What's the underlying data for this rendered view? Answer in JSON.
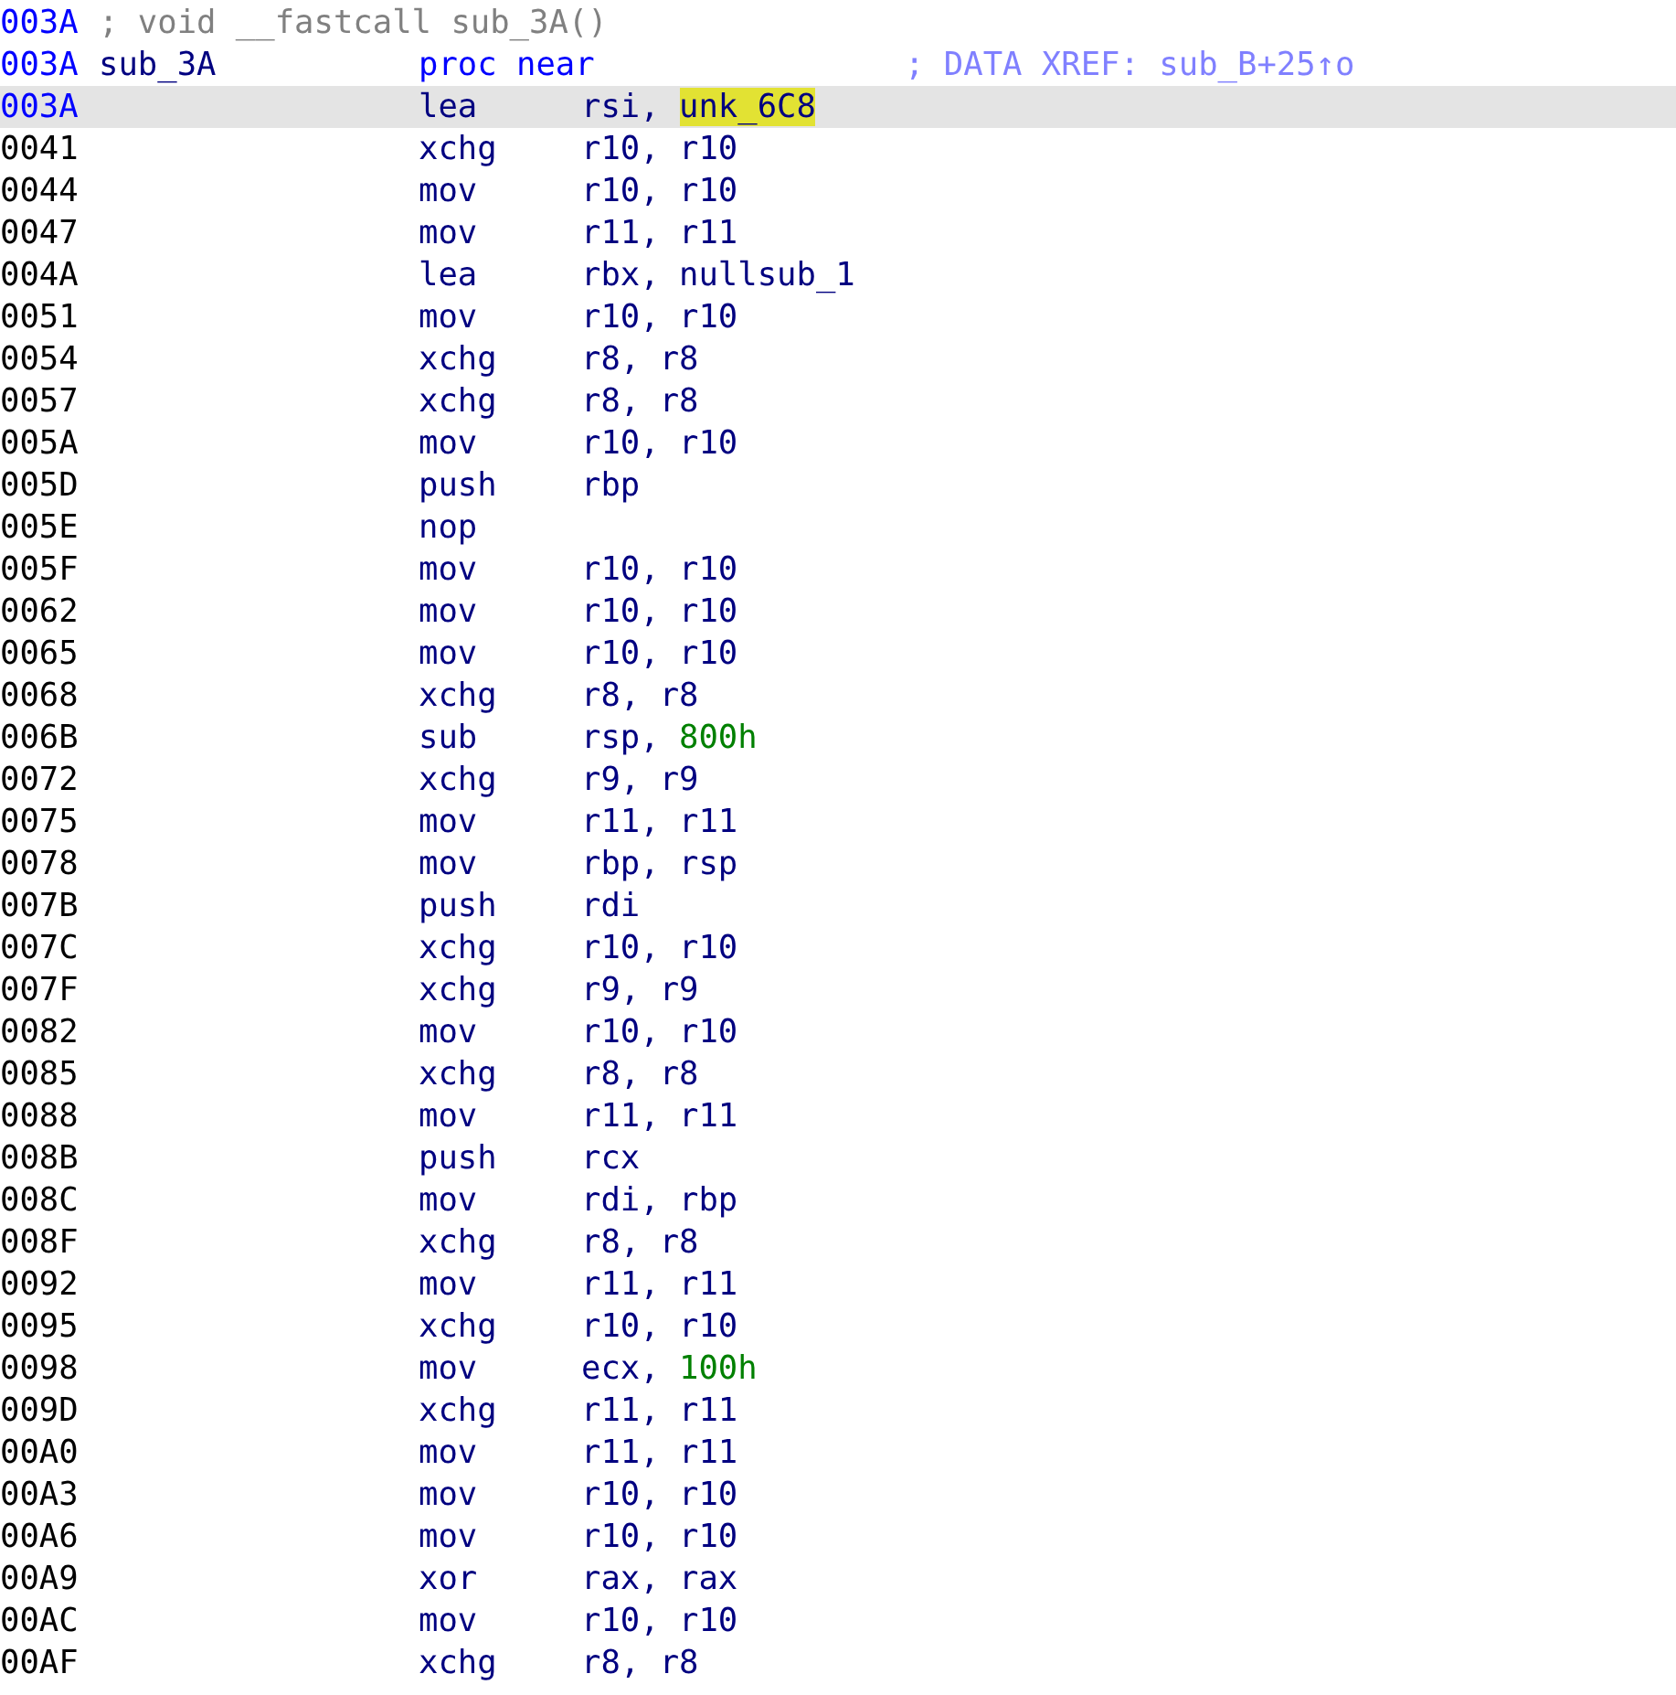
{
  "listing": {
    "lines": [
      {
        "kind": "comment",
        "address": "003A",
        "color": "#0000ff",
        "selected": false,
        "text": "; void __fastcall sub_3A()"
      },
      {
        "kind": "proc",
        "address": "003A",
        "color": "#0000ff",
        "selected": false,
        "label": "sub_3A",
        "directive": "proc near",
        "comment": "; DATA XREF: sub_B+25↑o"
      },
      {
        "kind": "instruction",
        "address": "003A",
        "color": "#0000ff",
        "selected": true,
        "mnemonic": "lea",
        "operands": [
          {
            "text": "rsi,",
            "kind": "register",
            "highlighted": false
          },
          {
            "text": "unk_6C8",
            "kind": "name",
            "highlighted": true
          }
        ]
      },
      {
        "kind": "instruction",
        "address": "0041",
        "color": "#000000",
        "selected": false,
        "mnemonic": "xchg",
        "operands": [
          {
            "text": "r10, r10",
            "kind": "register",
            "highlighted": false
          }
        ]
      },
      {
        "kind": "instruction",
        "address": "0044",
        "color": "#000000",
        "selected": false,
        "mnemonic": "mov",
        "operands": [
          {
            "text": "r10, r10",
            "kind": "register",
            "highlighted": false
          }
        ]
      },
      {
        "kind": "instruction",
        "address": "0047",
        "color": "#000000",
        "selected": false,
        "mnemonic": "mov",
        "operands": [
          {
            "text": "r11, r11",
            "kind": "register",
            "highlighted": false
          }
        ]
      },
      {
        "kind": "instruction",
        "address": "004A",
        "color": "#000000",
        "selected": false,
        "mnemonic": "lea",
        "operands": [
          {
            "text": "rbx, nullsub_1",
            "kind": "register",
            "highlighted": false
          }
        ]
      },
      {
        "kind": "instruction",
        "address": "0051",
        "color": "#000000",
        "selected": false,
        "mnemonic": "mov",
        "operands": [
          {
            "text": "r10, r10",
            "kind": "register",
            "highlighted": false
          }
        ]
      },
      {
        "kind": "instruction",
        "address": "0054",
        "color": "#000000",
        "selected": false,
        "mnemonic": "xchg",
        "operands": [
          {
            "text": "r8, r8",
            "kind": "register",
            "highlighted": false
          }
        ]
      },
      {
        "kind": "instruction",
        "address": "0057",
        "color": "#000000",
        "selected": false,
        "mnemonic": "xchg",
        "operands": [
          {
            "text": "r8, r8",
            "kind": "register",
            "highlighted": false
          }
        ]
      },
      {
        "kind": "instruction",
        "address": "005A",
        "color": "#000000",
        "selected": false,
        "mnemonic": "mov",
        "operands": [
          {
            "text": "r10, r10",
            "kind": "register",
            "highlighted": false
          }
        ]
      },
      {
        "kind": "instruction",
        "address": "005D",
        "color": "#000000",
        "selected": false,
        "mnemonic": "push",
        "operands": [
          {
            "text": "rbp",
            "kind": "register",
            "highlighted": false
          }
        ]
      },
      {
        "kind": "instruction",
        "address": "005E",
        "color": "#000000",
        "selected": false,
        "mnemonic": "nop"
      },
      {
        "kind": "instruction",
        "address": "005F",
        "color": "#000000",
        "selected": false,
        "mnemonic": "mov",
        "operands": [
          {
            "text": "r10, r10",
            "kind": "register",
            "highlighted": false
          }
        ]
      },
      {
        "kind": "instruction",
        "address": "0062",
        "color": "#000000",
        "selected": false,
        "mnemonic": "mov",
        "operands": [
          {
            "text": "r10, r10",
            "kind": "register",
            "highlighted": false
          }
        ]
      },
      {
        "kind": "instruction",
        "address": "0065",
        "color": "#000000",
        "selected": false,
        "mnemonic": "mov",
        "operands": [
          {
            "text": "r10, r10",
            "kind": "register",
            "highlighted": false
          }
        ]
      },
      {
        "kind": "instruction",
        "address": "0068",
        "color": "#000000",
        "selected": false,
        "mnemonic": "xchg",
        "operands": [
          {
            "text": "r8, r8",
            "kind": "register",
            "highlighted": false
          }
        ]
      },
      {
        "kind": "instruction",
        "address": "006B",
        "color": "#000000",
        "selected": false,
        "mnemonic": "sub",
        "operands": [
          {
            "text": "rsp,",
            "kind": "register",
            "highlighted": false
          },
          {
            "text": "800h",
            "kind": "number",
            "highlighted": false
          }
        ]
      },
      {
        "kind": "instruction",
        "address": "0072",
        "color": "#000000",
        "selected": false,
        "mnemonic": "xchg",
        "operands": [
          {
            "text": "r9, r9",
            "kind": "register",
            "highlighted": false
          }
        ]
      },
      {
        "kind": "instruction",
        "address": "0075",
        "color": "#000000",
        "selected": false,
        "mnemonic": "mov",
        "operands": [
          {
            "text": "r11, r11",
            "kind": "register",
            "highlighted": false
          }
        ]
      },
      {
        "kind": "instruction",
        "address": "0078",
        "color": "#000000",
        "selected": false,
        "mnemonic": "mov",
        "operands": [
          {
            "text": "rbp, rsp",
            "kind": "register",
            "highlighted": false
          }
        ]
      },
      {
        "kind": "instruction",
        "address": "007B",
        "color": "#000000",
        "selected": false,
        "mnemonic": "push",
        "operands": [
          {
            "text": "rdi",
            "kind": "register",
            "highlighted": false
          }
        ]
      },
      {
        "kind": "instruction",
        "address": "007C",
        "color": "#000000",
        "selected": false,
        "mnemonic": "xchg",
        "operands": [
          {
            "text": "r10, r10",
            "kind": "register",
            "highlighted": false
          }
        ]
      },
      {
        "kind": "instruction",
        "address": "007F",
        "color": "#000000",
        "selected": false,
        "mnemonic": "xchg",
        "operands": [
          {
            "text": "r9, r9",
            "kind": "register",
            "highlighted": false
          }
        ]
      },
      {
        "kind": "instruction",
        "address": "0082",
        "color": "#000000",
        "selected": false,
        "mnemonic": "mov",
        "operands": [
          {
            "text": "r10, r10",
            "kind": "register",
            "highlighted": false
          }
        ]
      },
      {
        "kind": "instruction",
        "address": "0085",
        "color": "#000000",
        "selected": false,
        "mnemonic": "xchg",
        "operands": [
          {
            "text": "r8, r8",
            "kind": "register",
            "highlighted": false
          }
        ]
      },
      {
        "kind": "instruction",
        "address": "0088",
        "color": "#000000",
        "selected": false,
        "mnemonic": "mov",
        "operands": [
          {
            "text": "r11, r11",
            "kind": "register",
            "highlighted": false
          }
        ]
      },
      {
        "kind": "instruction",
        "address": "008B",
        "color": "#000000",
        "selected": false,
        "mnemonic": "push",
        "operands": [
          {
            "text": "rcx",
            "kind": "register",
            "highlighted": false
          }
        ]
      },
      {
        "kind": "instruction",
        "address": "008C",
        "color": "#000000",
        "selected": false,
        "mnemonic": "mov",
        "operands": [
          {
            "text": "rdi, rbp",
            "kind": "register",
            "highlighted": false
          }
        ]
      },
      {
        "kind": "instruction",
        "address": "008F",
        "color": "#000000",
        "selected": false,
        "mnemonic": "xchg",
        "operands": [
          {
            "text": "r8, r8",
            "kind": "register",
            "highlighted": false
          }
        ]
      },
      {
        "kind": "instruction",
        "address": "0092",
        "color": "#000000",
        "selected": false,
        "mnemonic": "mov",
        "operands": [
          {
            "text": "r11, r11",
            "kind": "register",
            "highlighted": false
          }
        ]
      },
      {
        "kind": "instruction",
        "address": "0095",
        "color": "#000000",
        "selected": false,
        "mnemonic": "xchg",
        "operands": [
          {
            "text": "r10, r10",
            "kind": "register",
            "highlighted": false
          }
        ]
      },
      {
        "kind": "instruction",
        "address": "0098",
        "color": "#000000",
        "selected": false,
        "mnemonic": "mov",
        "operands": [
          {
            "text": "ecx,",
            "kind": "register",
            "highlighted": false
          },
          {
            "text": "100h",
            "kind": "number",
            "highlighted": false
          }
        ]
      },
      {
        "kind": "instruction",
        "address": "009D",
        "color": "#000000",
        "selected": false,
        "mnemonic": "xchg",
        "operands": [
          {
            "text": "r11, r11",
            "kind": "register",
            "highlighted": false
          }
        ]
      },
      {
        "kind": "instruction",
        "address": "00A0",
        "color": "#000000",
        "selected": false,
        "mnemonic": "mov",
        "operands": [
          {
            "text": "r11, r11",
            "kind": "register",
            "highlighted": false
          }
        ]
      },
      {
        "kind": "instruction",
        "address": "00A3",
        "color": "#000000",
        "selected": false,
        "mnemonic": "mov",
        "operands": [
          {
            "text": "r10, r10",
            "kind": "register",
            "highlighted": false
          }
        ]
      },
      {
        "kind": "instruction",
        "address": "00A6",
        "color": "#000000",
        "selected": false,
        "mnemonic": "mov",
        "operands": [
          {
            "text": "r10, r10",
            "kind": "register",
            "highlighted": false
          }
        ]
      },
      {
        "kind": "instruction",
        "address": "00A9",
        "color": "#000000",
        "selected": false,
        "mnemonic": "xor",
        "operands": [
          {
            "text": "rax, rax",
            "kind": "register",
            "highlighted": false
          }
        ]
      },
      {
        "kind": "instruction",
        "address": "00AC",
        "color": "#000000",
        "selected": false,
        "mnemonic": "mov",
        "operands": [
          {
            "text": "r10, r10",
            "kind": "register",
            "highlighted": false
          }
        ]
      },
      {
        "kind": "instruction",
        "address": "00AF",
        "color": "#000000",
        "selected": false,
        "mnemonic": "xchg",
        "operands": [
          {
            "text": "r8, r8",
            "kind": "register",
            "highlighted": false
          }
        ]
      }
    ]
  }
}
